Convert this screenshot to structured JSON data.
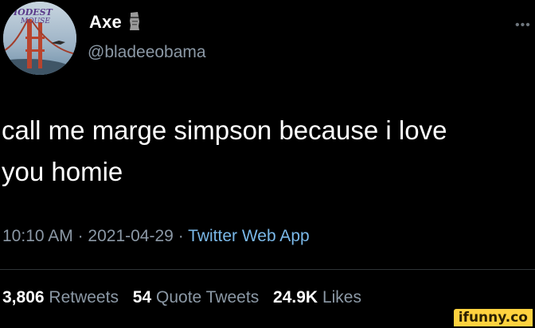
{
  "author": {
    "display_name": "Axe",
    "handle": "@bladeeobama",
    "badge_icon": "moai-icon",
    "avatar_text": "MODEST MOUSE"
  },
  "tweet": {
    "text_line1": "call me marge simpson because i love",
    "text_line2": "you homie"
  },
  "meta": {
    "time": "10:10 AM",
    "separator": "·",
    "date": "2021-04-29",
    "source": "Twitter Web App"
  },
  "stats": {
    "retweets_count": "3,806",
    "retweets_label": "Retweets",
    "quotes_count": "54",
    "quotes_label": "Quote Tweets",
    "likes_count": "24.9K",
    "likes_label": "Likes"
  },
  "watermark": {
    "text": "ifunny.co"
  },
  "colors": {
    "background": "#000000",
    "text_primary": "#ffffff",
    "text_secondary": "#8b98a5",
    "link": "#7ab8e8",
    "watermark_bg": "#ffd23f"
  }
}
